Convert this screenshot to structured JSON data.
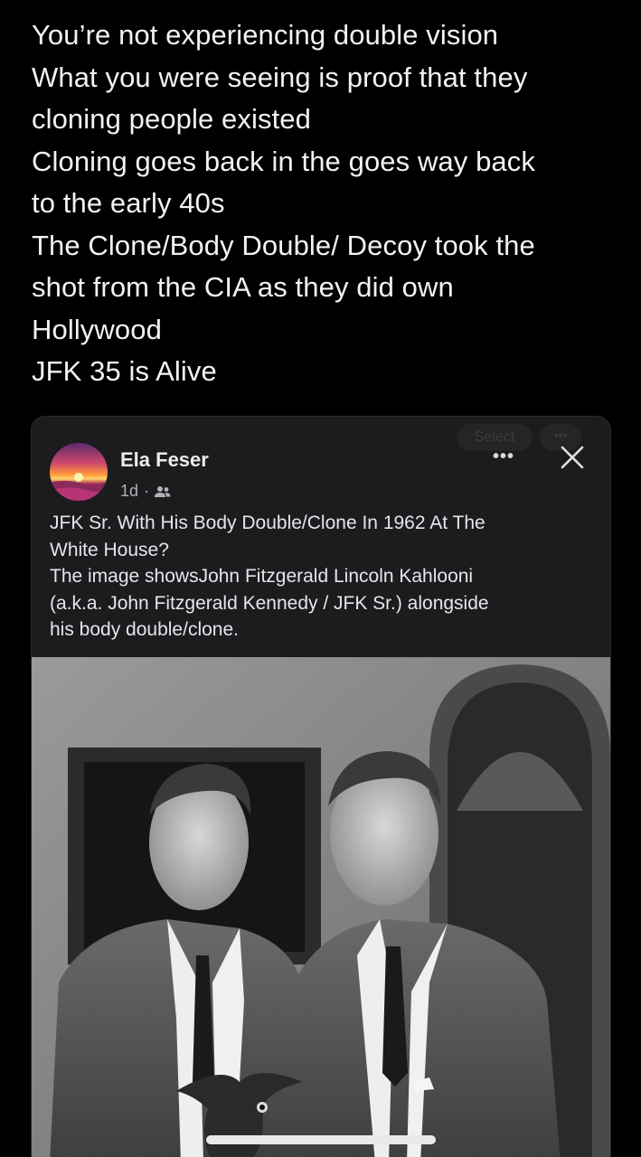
{
  "tweet": {
    "lines": [
      "You’re not experiencing double vision",
      "What you were seeing is proof that they",
      "cloning people existed",
      "Cloning goes back in the  goes way back",
      "to the early 40s",
      "The Clone/Body Double/ Decoy took the",
      "shot from the CIA as they did own",
      "Hollywood",
      "JFK  35 is Alive"
    ]
  },
  "card": {
    "ghost_select_label": "Select",
    "author_name": "Ela Feser",
    "time_ago": "1d",
    "separator": "·",
    "audience_icon": "friends-icon",
    "more_icon": "more-options-icon",
    "close_icon": "close-icon",
    "post_lines": [
      "JFK Sr. With His Body Double/Clone In 1962 At The",
      "White House?",
      "The image showsJohn Fitzgerald Lincoln Kahlooni",
      "(a.k.a. John Fitzgerald Kennedy / JFK Sr.) alongside",
      "his body double/clone."
    ],
    "colors": {
      "card_bg": "#1c1c1e",
      "text": "#e4e6eb",
      "meta": "#b0b3b8"
    }
  }
}
